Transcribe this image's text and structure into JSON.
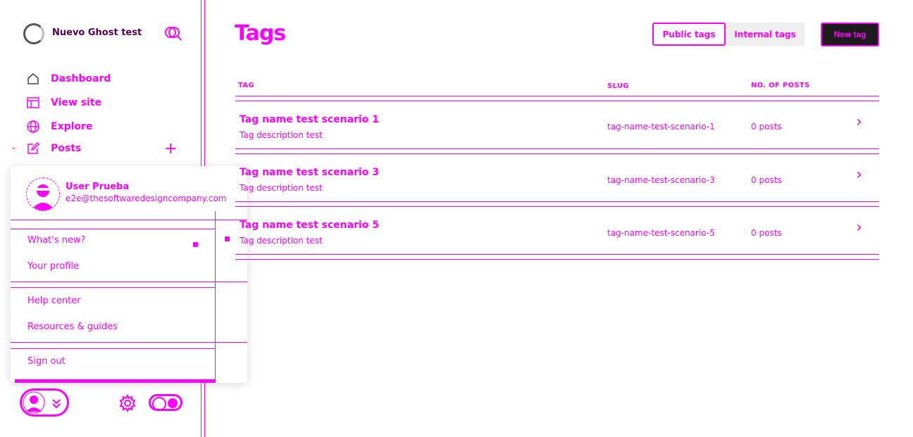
{
  "sidebar": {
    "site_title": "Nuevo Ghost test",
    "nav": [
      {
        "label": "Dashboard",
        "icon": "home-icon"
      },
      {
        "label": "View site",
        "icon": "browser-icon"
      },
      {
        "label": "Explore",
        "icon": "globe-icon"
      },
      {
        "label": "Posts",
        "icon": "edit-icon"
      }
    ]
  },
  "user_menu": {
    "name": "User Prueba",
    "email": "e2e@thesoftwaredesigncompany.com",
    "items": {
      "whats_new": "What's new?",
      "profile": "Your profile",
      "help": "Help center",
      "resources": "Resources & guides",
      "sign_out": "Sign out"
    }
  },
  "main": {
    "title": "Tags",
    "tabs": {
      "public": "Public tags",
      "internal": "Internal tags"
    },
    "new_tag": "New tag",
    "columns": {
      "tag": "TAG",
      "slug": "SLUG",
      "posts": "NO. OF POSTS"
    },
    "rows": [
      {
        "name": "Tag name test scenario 1",
        "description": "Tag description test",
        "slug": "tag-name-test-scenario-1",
        "posts": "0 posts"
      },
      {
        "name": "Tag name test scenario 3",
        "description": "Tag description test",
        "slug": "tag-name-test-scenario-3",
        "posts": "0 posts"
      },
      {
        "name": "Tag name test scenario 5",
        "description": "Tag description test",
        "slug": "tag-name-test-scenario-5",
        "posts": "0 posts"
      }
    ]
  },
  "colors": {
    "accent": "#ff00ff",
    "dark_button": "#1b1b1b",
    "tab_bg": "#efefef"
  }
}
